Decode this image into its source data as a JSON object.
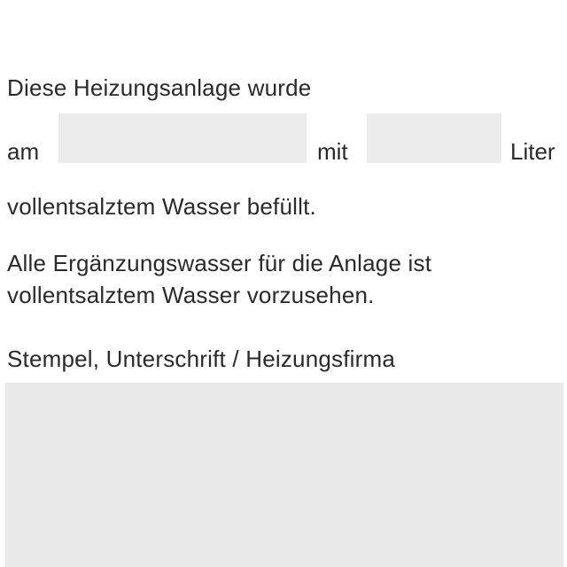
{
  "form": {
    "intro_text": "Diese Heizungsanlage wurde",
    "date_prefix": "am",
    "date_value": "",
    "amount_connector": "mit",
    "amount_value": "",
    "unit_label": "Liter",
    "fill_text": "vollentsalztem Wasser befüllt.",
    "note_line1": "Alle Ergänzungswasser für die Anlage ist",
    "note_line2": "vollentsalztem Wasser vorzusehen.",
    "signature_label": "Stempel, Unterschrift / Heizungsfirma"
  }
}
